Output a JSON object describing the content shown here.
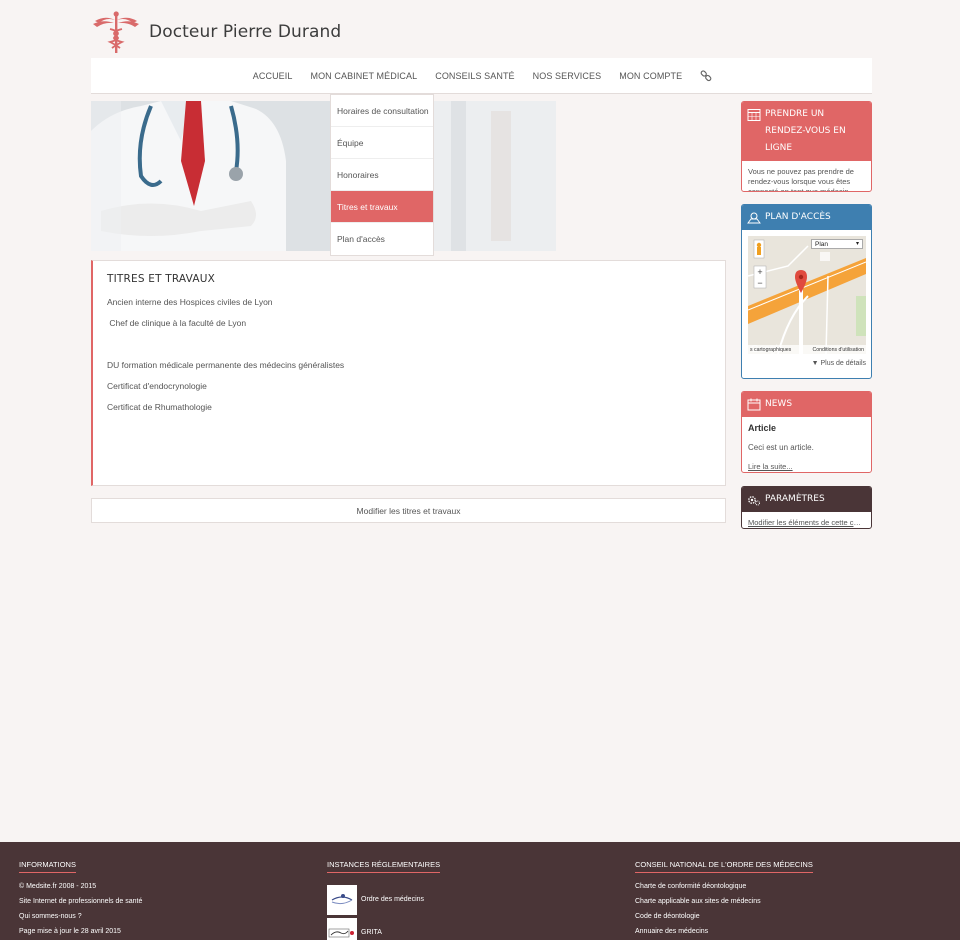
{
  "header": {
    "title": "Docteur Pierre Durand"
  },
  "nav": {
    "items": [
      "Accueil",
      "Mon cabinet médical",
      "Conseils santé",
      "Nos services",
      "Mon compte"
    ]
  },
  "dropdown": {
    "items": [
      "Horaires de consultation",
      "Équipe",
      "Honoraires",
      "Titres et travaux",
      "Plan d'accès"
    ],
    "active": "Titres et travaux"
  },
  "content": {
    "title": "Titres et travaux",
    "lines": [
      "Ancien interne des Hospices civiles de Lyon",
      " Chef de clinique à la faculté de Lyon",
      "",
      "DU formation médicale permanente des médecins généralistes",
      "Certificat d'endocrynologie",
      "Certificat de Rhumathologie"
    ],
    "edit_button": "Modifier les titres et travaux"
  },
  "sidebar": {
    "rdv": {
      "title": "Prendre un rendez-vous en ligne",
      "text": "Vous ne pouvez pas prendre de rendez-vous lorsque vous êtes connecté en tant que médecin."
    },
    "map": {
      "title": "Plan d'accès",
      "map_type": "Plan",
      "credit": "s cartographiques",
      "terms": "Conditions d'utilisation",
      "more": "▼ Plus de détails"
    },
    "news": {
      "title": "News",
      "article_title": "Article",
      "article_text": "Ceci est un article.",
      "read_more": "Lire la suite..."
    },
    "params": {
      "title": "Paramètres",
      "link": "Modifier les éléments de cette colonne"
    }
  },
  "footer": {
    "informations": {
      "title": "Informations",
      "lines": [
        "© Medsite.fr 2008 - 2015",
        "Site Internet de professionnels de santé",
        "Qui sommes-nous ?",
        "Page mise à jour le 28 avril 2015"
      ]
    },
    "instances": {
      "title": "Instances réglementaires",
      "items": [
        "Ordre des médecins",
        "GRITA"
      ]
    },
    "conseil": {
      "title": "Conseil national de l'ordre des médecins",
      "lines": [
        "Charte de conformité déontologique",
        "Charte applicable aux sites de médecins",
        "Code de déontologie",
        "Annuaire des médecins"
      ]
    }
  },
  "colors": {
    "accent": "#e06666",
    "blue": "#3e7fb0",
    "dark": "#4a3537",
    "background": "#f8f4f3"
  }
}
